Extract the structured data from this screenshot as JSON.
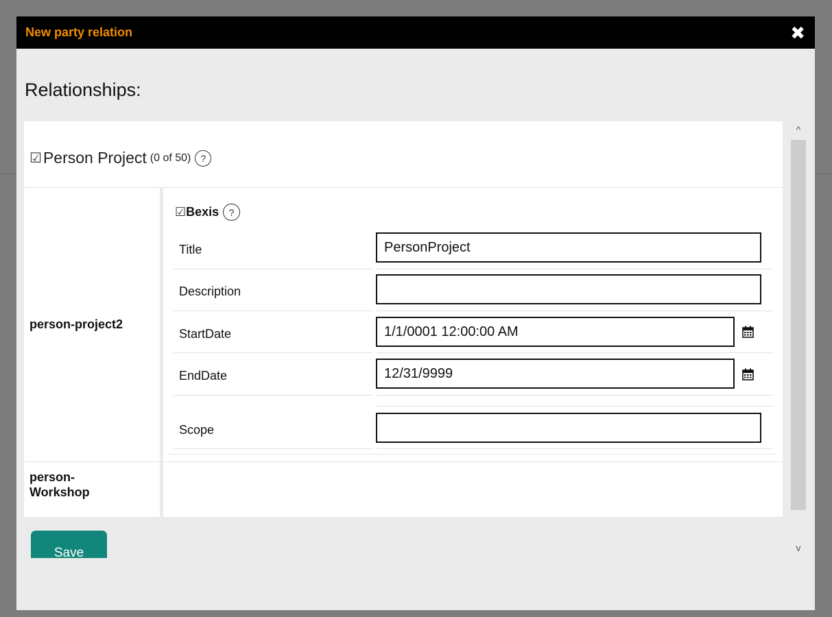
{
  "dialog": {
    "title": "New party relation",
    "close_symbol": "✖",
    "heading": "Relationships:"
  },
  "group": {
    "checkbox": "☑",
    "title": "Person Project",
    "count": "(0 of 50)",
    "help": "?"
  },
  "rows": [
    {
      "label": "person-project2"
    },
    {
      "label": "person-\nWorkshop"
    }
  ],
  "subgroup": {
    "checkbox": "☑",
    "title": "Bexis",
    "help": "?"
  },
  "fields": [
    {
      "label": "Title",
      "value": "PersonProject",
      "placeholder": ""
    },
    {
      "label": "Description",
      "value": "",
      "placeholder": ""
    },
    {
      "label": "StartDate",
      "value": "1/1/0001 12:00:00 AM",
      "placeholder": "",
      "icon": "calendar-icon"
    },
    {
      "label": "EndDate",
      "value": "12/31/9999",
      "placeholder": "",
      "icon": "calendar-icon"
    },
    {
      "label": "Scope",
      "value": "",
      "placeholder": ""
    }
  ],
  "actions": {
    "save_label": "Save"
  },
  "scrollbar": {
    "up": "^",
    "down": "v"
  },
  "colors": {
    "title": "#f28c00",
    "titlebar": "#000000",
    "save_button": "#12867a",
    "dialog_bg": "#ebebeb",
    "overlay": "#7d7d7d"
  }
}
